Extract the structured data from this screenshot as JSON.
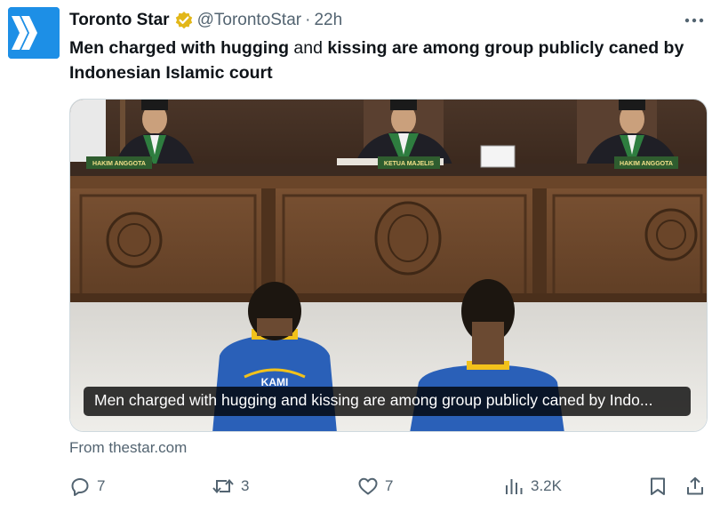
{
  "tweet": {
    "author_name": "Toronto Star",
    "handle": "@TorontoStar",
    "time": "22h",
    "text_part1": "Men charged with hugging",
    "text_part2": "and",
    "text_part3": "kissing are among group publicly caned by Indonesian Islamic court"
  },
  "media": {
    "caption": "Men charged with hugging and kissing are among group publicly caned by Indo...",
    "sign_left": "HAKIM ANGGOTA",
    "sign_center": "KETUA MAJELIS",
    "sign_right": "HAKIM ANGGOTA",
    "shirt_text": "KAMI"
  },
  "source": "From thestar.com",
  "actions": {
    "replies": "7",
    "reposts": "3",
    "likes": "7",
    "views": "3.2K"
  },
  "colors": {
    "accent": "#1d9bf0",
    "avatar": "#1d8fe6",
    "verified_badge": "#e2b719",
    "muted_text": "#536471"
  },
  "icons": [
    "toronto-star-logo",
    "verified-badge-icon",
    "more-icon",
    "reply-icon",
    "repost-icon",
    "like-icon",
    "views-icon",
    "bookmark-icon",
    "share-icon"
  ]
}
